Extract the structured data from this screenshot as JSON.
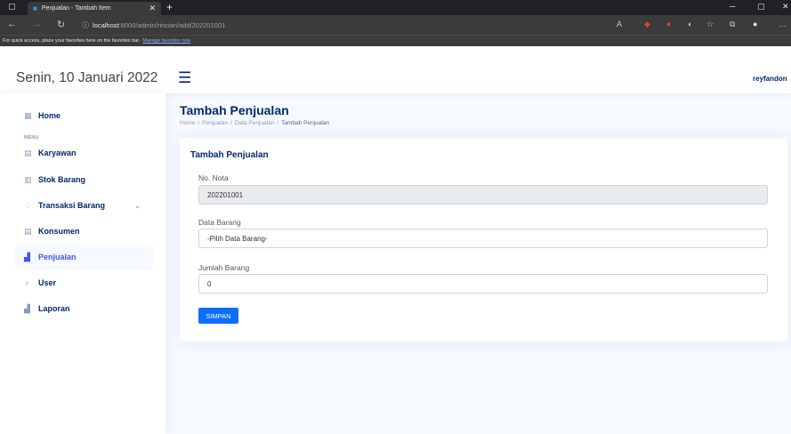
{
  "browser": {
    "tab_title": "Penjualan - Tambah Item",
    "new_tab": "+",
    "url_host": "localhost",
    "url_path": ":8000/admin/rincian/add/202201001",
    "favorites_text": "For quick access, place your favorites here on the favorites bar.",
    "favorites_link": "Manage favorites now"
  },
  "header": {
    "date": "Senin, 10 Januari 2022",
    "user": "reyfandon"
  },
  "sidebar": {
    "menu_heading": "MENU",
    "items": [
      {
        "label": "Home",
        "icon": "grid-icon"
      },
      {
        "label": "Karyawan",
        "icon": "file-icon"
      },
      {
        "label": "Stok Barang",
        "icon": "box-icon"
      },
      {
        "label": "Transaksi Barang",
        "icon": "gem-icon"
      },
      {
        "label": "Konsumen",
        "icon": "list-icon"
      },
      {
        "label": "Penjualan",
        "icon": "chart-icon"
      },
      {
        "label": "User",
        "icon": "person-icon"
      },
      {
        "label": "Laporan",
        "icon": "chart-icon"
      }
    ]
  },
  "main": {
    "page_title": "Tambah Penjualan",
    "breadcrumb": [
      "Home",
      "Penjualan",
      "Data Penjualan",
      "Tambah Penjualan"
    ],
    "separator": "/",
    "card_title": "Tambah Penjualan",
    "fields": {
      "no_nota_label": "No. Nota",
      "no_nota_value": "202201001",
      "data_barang_label": "Data Barang",
      "data_barang_value": "-Pilih Data Barang-",
      "jumlah_label": "Jumlah Barang",
      "jumlah_value": "0"
    },
    "save_label": "SIMPAN"
  },
  "colors": {
    "accent": "#4154f1",
    "brand": "#012970",
    "button": "#0d6efd"
  }
}
